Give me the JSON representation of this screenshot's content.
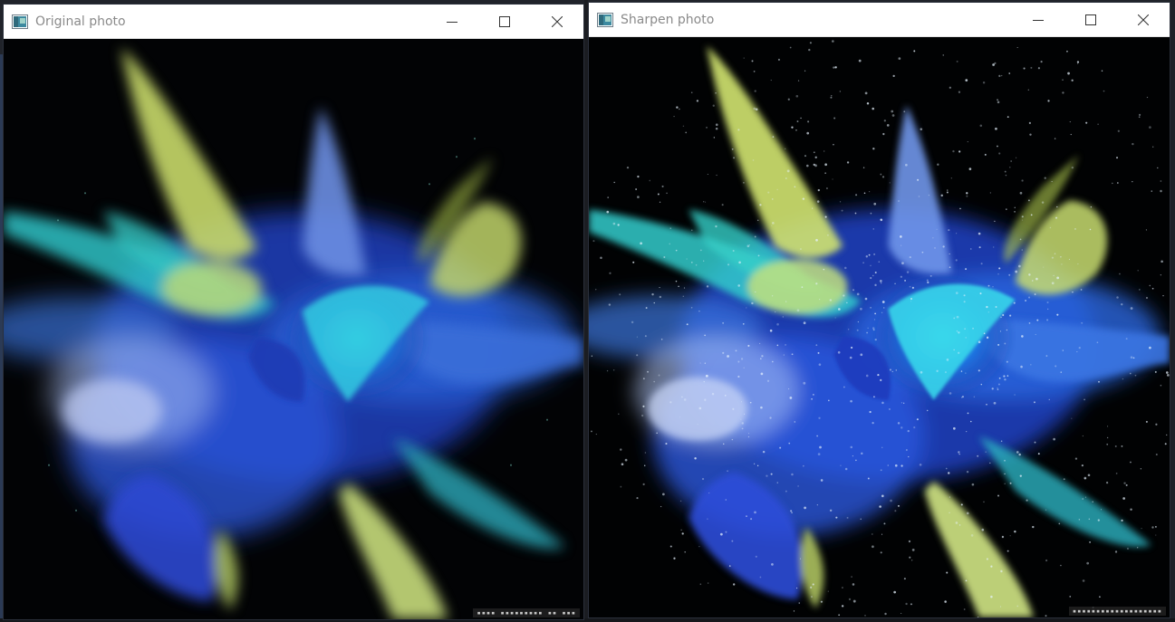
{
  "windows": [
    {
      "id": "original",
      "title": "Original photo",
      "controls": {
        "minimize": "minimize-icon",
        "maximize": "maximize-icon",
        "close": "close-icon"
      }
    },
    {
      "id": "sharpen",
      "title": "Sharpen photo",
      "controls": {
        "minimize": "minimize-icon",
        "maximize": "maximize-icon",
        "close": "close-icon"
      }
    }
  ],
  "colors": {
    "background": "#000000",
    "titlebar": "#ffffff",
    "title_text": "#8a8a8a",
    "powder_deep_blue": "#1f49c9",
    "powder_cyan": "#25c4d8",
    "powder_yellow_green": "#c9e07a",
    "powder_lavender": "#8fa6e6"
  }
}
